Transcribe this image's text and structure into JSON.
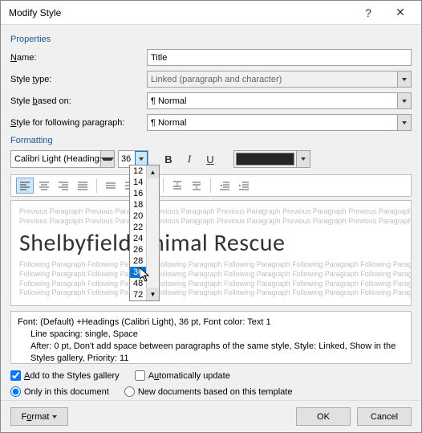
{
  "titlebar": {
    "title": "Modify Style",
    "help": "?",
    "close": "✕"
  },
  "sections": {
    "properties": "Properties",
    "formatting": "Formatting"
  },
  "labels": {
    "name": "Name:",
    "style_type": "Style type:",
    "based_on": "Style based on:",
    "following": "Style for following paragraph:"
  },
  "fields": {
    "name": "Title",
    "style_type": "Linked (paragraph and character)",
    "based_on": "¶ Normal",
    "following": "¶ Normal"
  },
  "font": {
    "family": "Calibri Light (Headings)",
    "size": "36"
  },
  "size_options": [
    "12",
    "14",
    "16",
    "18",
    "20",
    "22",
    "24",
    "26",
    "28",
    "36",
    "48",
    "72"
  ],
  "size_selected": "36",
  "buttons": {
    "bold": "B",
    "italic": "I",
    "underline": "U"
  },
  "preview": {
    "ghost_before": "Previous Paragraph Previous Paragraph Previous Paragraph Previous Paragraph Previous Paragraph Previous Paragraph Previous Paragraph Previous",
    "sample": "Shelbyfield Animal Rescue",
    "ghost_after1": "Following Paragraph Following Paragraph Following Paragraph Following Paragraph Following Paragraph Following Paragraph",
    "ghost_after2": "Following Paragraph Following Paragraph Following Paragraph Following Paragraph Following Paragraph Following Paragraph",
    "ghost_after3": "Following Paragraph Following Paragraph Following Paragraph Following Paragraph Following Paragraph Following Paragraph",
    "ghost_after4": "Following Paragraph Following Paragraph Following Paragraph Following Paragraph Following Paragraph Following Paragraph"
  },
  "description": {
    "l1": "Font: (Default) +Headings (Calibri Light), 36 pt, Font color: Text 1",
    "l2": "Line spacing:  single, Space",
    "l3": "After:  0 pt, Don't add space between paragraphs of the same style, Style: Linked, Show in the Styles gallery, Priority: 11"
  },
  "checks": {
    "add_gallery": "Add to the Styles gallery",
    "auto_update": "Automatically update",
    "only_doc": "Only in this document",
    "new_docs": "New documents based on this template"
  },
  "footer": {
    "format": "Format",
    "ok": "OK",
    "cancel": "Cancel"
  }
}
